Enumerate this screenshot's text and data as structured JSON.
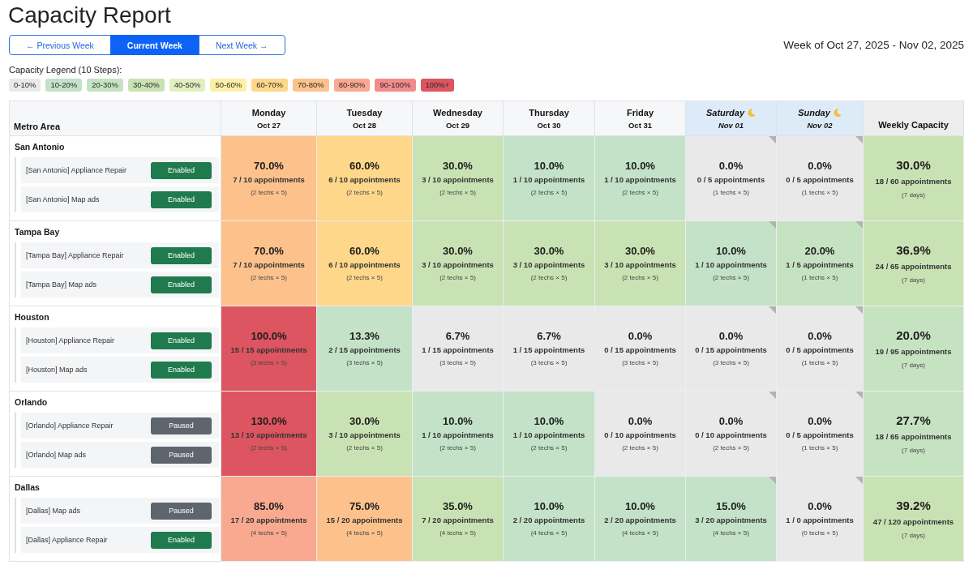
{
  "title": "Capacity Report",
  "week_nav": [
    {
      "label": "← Previous Week",
      "selected": false
    },
    {
      "label": "Current Week",
      "selected": true
    },
    {
      "label": "Next Week →",
      "selected": false
    }
  ],
  "week_range": "Week of Oct 27, 2025 - Nov 02, 2025",
  "legend": {
    "label": "Capacity Legend (10 Steps):",
    "steps": [
      {
        "label": "0-10%",
        "color": "#e9e9e9"
      },
      {
        "label": "10-20%",
        "color": "#c3e2c7"
      },
      {
        "label": "20-30%",
        "color": "#c6e3c1"
      },
      {
        "label": "30-40%",
        "color": "#c9e2b3"
      },
      {
        "label": "40-50%",
        "color": "#e3efbf"
      },
      {
        "label": "50-60%",
        "color": "#fdf0a6"
      },
      {
        "label": "60-70%",
        "color": "#fed78b"
      },
      {
        "label": "70-80%",
        "color": "#fdc28c"
      },
      {
        "label": "80-90%",
        "color": "#f9a98f"
      },
      {
        "label": "90-100%",
        "color": "#f38b8b"
      },
      {
        "label": "100%+",
        "color": "#dc5560"
      }
    ]
  },
  "table": {
    "metro_header": "Metro Area",
    "weekly_header": "Weekly Capacity",
    "days": [
      {
        "day": "Monday",
        "date": "Oct 27",
        "weekend": false
      },
      {
        "day": "Tuesday",
        "date": "Oct 28",
        "weekend": false
      },
      {
        "day": "Wednesday",
        "date": "Oct 29",
        "weekend": false
      },
      {
        "day": "Thursday",
        "date": "Oct 30",
        "weekend": false
      },
      {
        "day": "Friday",
        "date": "Oct 31",
        "weekend": false
      },
      {
        "day": "Saturday",
        "date": "Nov 01",
        "weekend": true
      },
      {
        "day": "Sunday",
        "date": "Nov 02",
        "weekend": true
      }
    ],
    "rows": [
      {
        "metro": "San Antonio",
        "campaigns": [
          {
            "name": "[San Antonio] Appliance Repair",
            "status": "Enabled",
            "enabled": true
          },
          {
            "name": "[San Antonio] Map ads",
            "status": "Enabled",
            "enabled": true
          }
        ],
        "cells": [
          {
            "percent": "70.0%",
            "appointments": "7 / 10 appointments",
            "techs": "(2 techs × 5)",
            "color": "#fdc28c"
          },
          {
            "percent": "60.0%",
            "appointments": "6 / 10 appointments",
            "techs": "(2 techs × 5)",
            "color": "#fed78b"
          },
          {
            "percent": "30.0%",
            "appointments": "3 / 10 appointments",
            "techs": "(2 techs × 5)",
            "color": "#c9e2b3"
          },
          {
            "percent": "10.0%",
            "appointments": "1 / 10 appointments",
            "techs": "(2 techs × 5)",
            "color": "#c3e2c7"
          },
          {
            "percent": "10.0%",
            "appointments": "1 / 10 appointments",
            "techs": "(2 techs × 5)",
            "color": "#c3e2c7"
          },
          {
            "percent": "0.0%",
            "appointments": "0 / 5 appointments",
            "techs": "(1 techs × 5)",
            "color": "#e9e9e9"
          },
          {
            "percent": "0.0%",
            "appointments": "0 / 5 appointments",
            "techs": "(1 techs × 5)",
            "color": "#e9e9e9"
          }
        ],
        "weekly": {
          "percent": "30.0%",
          "appointments": "18 / 60 appointments",
          "period": "(7 days)",
          "color": "#c9e2b3"
        }
      },
      {
        "metro": "Tampa Bay",
        "campaigns": [
          {
            "name": "[Tampa Bay] Appliance Repair",
            "status": "Enabled",
            "enabled": true
          },
          {
            "name": "[Tampa Bay] Map ads",
            "status": "Enabled",
            "enabled": true
          }
        ],
        "cells": [
          {
            "percent": "70.0%",
            "appointments": "7 / 10 appointments",
            "techs": "(2 techs × 5)",
            "color": "#fdc28c"
          },
          {
            "percent": "60.0%",
            "appointments": "6 / 10 appointments",
            "techs": "(2 techs × 5)",
            "color": "#fed78b"
          },
          {
            "percent": "30.0%",
            "appointments": "3 / 10 appointments",
            "techs": "(2 techs × 5)",
            "color": "#c9e2b3"
          },
          {
            "percent": "30.0%",
            "appointments": "3 / 10 appointments",
            "techs": "(2 techs × 5)",
            "color": "#c9e2b3"
          },
          {
            "percent": "30.0%",
            "appointments": "3 / 10 appointments",
            "techs": "(2 techs × 5)",
            "color": "#c9e2b3"
          },
          {
            "percent": "10.0%",
            "appointments": "1 / 10 appointments",
            "techs": "(2 techs × 5)",
            "color": "#c3e2c7"
          },
          {
            "percent": "20.0%",
            "appointments": "1 / 5 appointments",
            "techs": "(1 techs × 5)",
            "color": "#c6e3c1"
          }
        ],
        "weekly": {
          "percent": "36.9%",
          "appointments": "24 / 65 appointments",
          "period": "(7 days)",
          "color": "#c9e2b3"
        }
      },
      {
        "metro": "Houston",
        "campaigns": [
          {
            "name": "[Houston] Appliance Repair",
            "status": "Enabled",
            "enabled": true
          },
          {
            "name": "[Houston] Map ads",
            "status": "Enabled",
            "enabled": true
          }
        ],
        "cells": [
          {
            "percent": "100.0%",
            "appointments": "15 / 15 appointments",
            "techs": "(3 techs × 5)",
            "color": "#dc5560"
          },
          {
            "percent": "13.3%",
            "appointments": "2 / 15 appointments",
            "techs": "(3 techs × 5)",
            "color": "#c3e2c7"
          },
          {
            "percent": "6.7%",
            "appointments": "1 / 15 appointments",
            "techs": "(3 techs × 5)",
            "color": "#e9e9e9"
          },
          {
            "percent": "6.7%",
            "appointments": "1 / 15 appointments",
            "techs": "(3 techs × 5)",
            "color": "#e9e9e9"
          },
          {
            "percent": "0.0%",
            "appointments": "0 / 15 appointments",
            "techs": "(3 techs × 5)",
            "color": "#e9e9e9"
          },
          {
            "percent": "0.0%",
            "appointments": "0 / 15 appointments",
            "techs": "(3 techs × 5)",
            "color": "#e9e9e9"
          },
          {
            "percent": "0.0%",
            "appointments": "0 / 5 appointments",
            "techs": "(1 techs × 5)",
            "color": "#e9e9e9"
          }
        ],
        "weekly": {
          "percent": "20.0%",
          "appointments": "19 / 95 appointments",
          "period": "(7 days)",
          "color": "#c6e3c1"
        }
      },
      {
        "metro": "Orlando",
        "campaigns": [
          {
            "name": "[Orlando] Appliance Repair",
            "status": "Paused",
            "enabled": false
          },
          {
            "name": "[Orlando] Map ads",
            "status": "Paused",
            "enabled": false
          }
        ],
        "cells": [
          {
            "percent": "130.0%",
            "appointments": "13 / 10 appointments",
            "techs": "(2 techs × 5)",
            "color": "#dc5560"
          },
          {
            "percent": "30.0%",
            "appointments": "3 / 10 appointments",
            "techs": "(2 techs × 5)",
            "color": "#c9e2b3"
          },
          {
            "percent": "10.0%",
            "appointments": "1 / 10 appointments",
            "techs": "(2 techs × 5)",
            "color": "#c3e2c7"
          },
          {
            "percent": "10.0%",
            "appointments": "1 / 10 appointments",
            "techs": "(2 techs × 5)",
            "color": "#c3e2c7"
          },
          {
            "percent": "0.0%",
            "appointments": "0 / 10 appointments",
            "techs": "(2 techs × 5)",
            "color": "#e9e9e9"
          },
          {
            "percent": "0.0%",
            "appointments": "0 / 10 appointments",
            "techs": "(2 techs × 5)",
            "color": "#e9e9e9"
          },
          {
            "percent": "0.0%",
            "appointments": "0 / 5 appointments",
            "techs": "(1 techs × 5)",
            "color": "#e9e9e9"
          }
        ],
        "weekly": {
          "percent": "27.7%",
          "appointments": "18 / 65 appointments",
          "period": "(7 days)",
          "color": "#c6e3c1"
        }
      },
      {
        "metro": "Dallas",
        "campaigns": [
          {
            "name": "[Dallas] Map ads",
            "status": "Paused",
            "enabled": false
          },
          {
            "name": "[Dallas] Appliance Repair",
            "status": "Enabled",
            "enabled": true
          }
        ],
        "cells": [
          {
            "percent": "85.0%",
            "appointments": "17 / 20 appointments",
            "techs": "(4 techs × 5)",
            "color": "#f9a98f"
          },
          {
            "percent": "75.0%",
            "appointments": "15 / 20 appointments",
            "techs": "(4 techs × 5)",
            "color": "#fdc28c"
          },
          {
            "percent": "35.0%",
            "appointments": "7 / 20 appointments",
            "techs": "(4 techs × 5)",
            "color": "#c9e2b3"
          },
          {
            "percent": "10.0%",
            "appointments": "2 / 20 appointments",
            "techs": "(4 techs × 5)",
            "color": "#c3e2c7"
          },
          {
            "percent": "10.0%",
            "appointments": "2 / 20 appointments",
            "techs": "(4 techs × 5)",
            "color": "#c3e2c7"
          },
          {
            "percent": "15.0%",
            "appointments": "3 / 20 appointments",
            "techs": "(4 techs × 5)",
            "color": "#c3e2c7"
          },
          {
            "percent": "0.0%",
            "appointments": "1 / 0 appointments",
            "techs": "(0 techs × 5)",
            "color": "#e9e9e9"
          }
        ],
        "weekly": {
          "percent": "39.2%",
          "appointments": "47 / 120 appointments",
          "period": "(7 days)",
          "color": "#c9e2b3"
        }
      }
    ]
  }
}
